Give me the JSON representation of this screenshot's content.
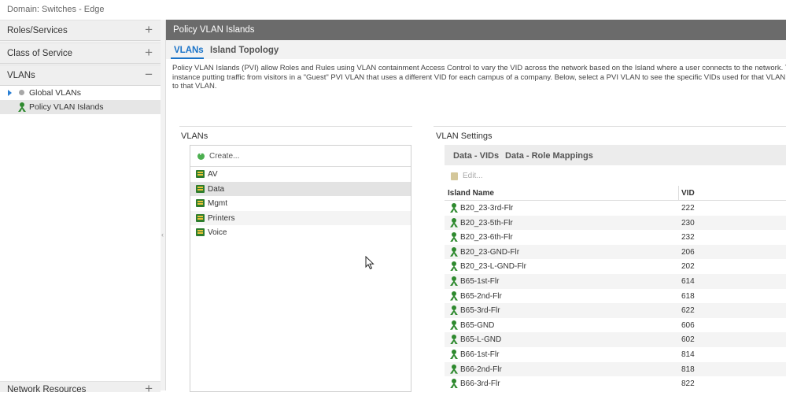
{
  "domain_label": "Domain: Switches - Edge",
  "sidebar": {
    "sections": [
      {
        "label": "Roles/Services",
        "sign": "+"
      },
      {
        "label": "Class of Service",
        "sign": "+"
      },
      {
        "label": "VLANs",
        "sign": "−"
      },
      {
        "label": "Network Resources",
        "sign": "+"
      }
    ],
    "tree": [
      {
        "label": "Global VLANs"
      },
      {
        "label": "Policy VLAN Islands"
      }
    ]
  },
  "main": {
    "header": "Policy VLAN Islands",
    "tabs": [
      {
        "label": "VLANs",
        "active": true
      },
      {
        "label": "Island Topology",
        "active": false
      }
    ],
    "description": [
      "Policy VLAN Islands (PVI) allow Roles and Rules using VLAN containment Access Control to vary the VID across the network based on the Island where a user connects to the network. This can",
      "instance putting traffic from visitors in a \"Guest\" PVI VLAN that uses a different VID for each campus of a company. Below, select a PVI VLAN to see the specific VIDs used for that VLAN in eac",
      "to that VLAN."
    ]
  },
  "vlans_panel": {
    "title": "VLANs",
    "create_label": "Create...",
    "items": [
      "AV",
      "Data",
      "Mgmt",
      "Printers",
      "Voice"
    ],
    "selected": "Data"
  },
  "settings_panel": {
    "title": "VLAN Settings",
    "tabs": [
      "Data - VIDs",
      "Data - Role Mappings"
    ],
    "edit_label": "Edit...",
    "columns": [
      "Island Name",
      "VID"
    ],
    "rows": [
      {
        "name": "B20_23-3rd-Flr",
        "vid": "222"
      },
      {
        "name": "B20_23-5th-Flr",
        "vid": "230"
      },
      {
        "name": "B20_23-6th-Flr",
        "vid": "232"
      },
      {
        "name": "B20_23-GND-Flr",
        "vid": "206"
      },
      {
        "name": "B20_23-L-GND-Flr",
        "vid": "202"
      },
      {
        "name": "B65-1st-Flr",
        "vid": "614"
      },
      {
        "name": "B65-2nd-Flr",
        "vid": "618"
      },
      {
        "name": "B65-3rd-Flr",
        "vid": "622"
      },
      {
        "name": "B65-GND",
        "vid": "606"
      },
      {
        "name": "B65-L-GND",
        "vid": "602"
      },
      {
        "name": "B66-1st-Flr",
        "vid": "814"
      },
      {
        "name": "B66-2nd-Flr",
        "vid": "818"
      },
      {
        "name": "B66-3rd-Flr",
        "vid": "822"
      }
    ]
  },
  "colors": {
    "header_bg": "#6b6b6b",
    "accent_blue": "#1a73c8",
    "icon_green": "#2f8a2f"
  }
}
